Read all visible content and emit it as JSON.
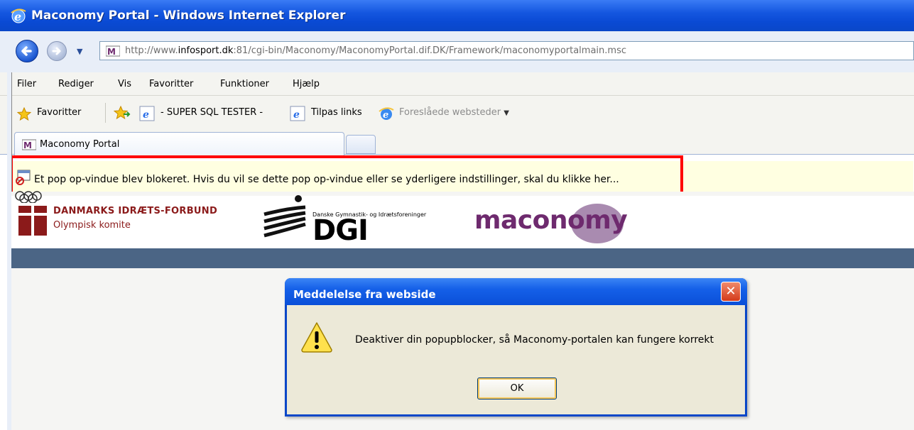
{
  "window": {
    "title": "Maconomy Portal - Windows Internet Explorer",
    "address_prefix": "http://www.",
    "address_domain": "infosport.dk",
    "address_rest": ":81/cgi-bin/Maconomy/MaconomyPortal.dif.DK/Framework/maconomyportalmain.msc"
  },
  "menu": {
    "items": [
      "Filer",
      "Rediger",
      "Vis",
      "Favoritter",
      "Funktioner",
      "Hjælp"
    ]
  },
  "favorites_bar": {
    "favorites_label": "Favoritter",
    "link1": "- SUPER SQL TESTER -",
    "link2": "Tilpas links",
    "link3": "Foreslåede websteder"
  },
  "tabs": {
    "active_label": "Maconomy Portal"
  },
  "infobar": {
    "message": "Et pop op-vindue blev blokeret. Hvis du vil se dette pop op-vindue eller se yderligere indstillinger, skal du klikke her..."
  },
  "page": {
    "dif_name": "DANMARKS IDRÆTS-FORBUND",
    "dif_sub": "Olympisk komite",
    "dgi_sub": "Danske Gymnastik- og Idrætsforeninger",
    "dgi_name": "DGI",
    "maconomy": "maconomy"
  },
  "dialog": {
    "title": "Meddelelse fra webside",
    "message": "Deaktiver din popupblocker, så Maconomy-portalen kan fungere korrekt",
    "ok_label": "OK",
    "close_glyph": "✕"
  },
  "colors": {
    "titlebar": "#0a47c8",
    "highlight": "#ff0000",
    "infobar": "#ffffe1",
    "dif_red": "#8b1a1a",
    "maconomy_purple": "#6e2a6e",
    "band": "#4b6585"
  },
  "icons": [
    "ie-icon",
    "back-arrow-icon",
    "forward-arrow-icon",
    "favicon-maconomy-icon",
    "favorites-star-icon",
    "add-favorite-icon",
    "ie-page-icon",
    "suggested-sites-icon",
    "popup-blocked-icon",
    "warning-icon",
    "close-icon"
  ]
}
